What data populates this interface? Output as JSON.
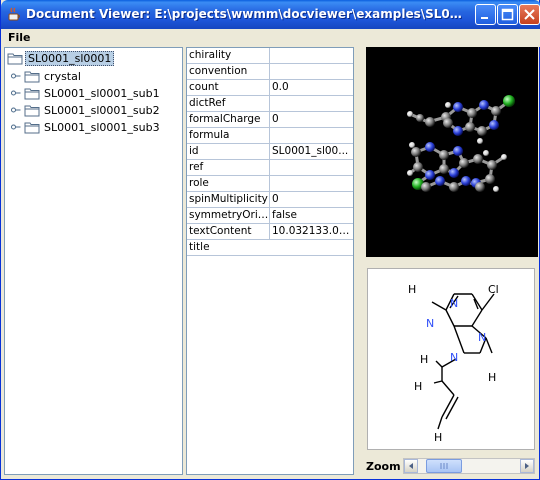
{
  "window": {
    "title": "Document Viewer: E:\\projects\\wwmm\\docviewer\\examples\\SL0001_sl0001..."
  },
  "menu": {
    "file_label": "File"
  },
  "tree": {
    "root": "SL0001_sl0001",
    "children": [
      "crystal",
      "SL0001_sl0001_sub1",
      "SL0001_sl0001_sub2",
      "SL0001_sl0001_sub3"
    ]
  },
  "properties": [
    {
      "key": "chirality",
      "value": ""
    },
    {
      "key": "convention",
      "value": ""
    },
    {
      "key": "count",
      "value": "0.0"
    },
    {
      "key": "dictRef",
      "value": ""
    },
    {
      "key": "formalCharge",
      "value": "0"
    },
    {
      "key": "formula",
      "value": ""
    },
    {
      "key": "id",
      "value": "SL0001_sl00..."
    },
    {
      "key": "ref",
      "value": ""
    },
    {
      "key": "role",
      "value": ""
    },
    {
      "key": "spinMultiplicity",
      "value": "0"
    },
    {
      "key": "symmetryOrie...",
      "value": "false"
    },
    {
      "key": "textContent",
      "value": "10.032133.06..."
    },
    {
      "key": "title",
      "value": ""
    }
  ],
  "structure2d": {
    "atoms": {
      "h1": "H",
      "cl": "Cl",
      "n1": "N",
      "n2": "N",
      "n3": "N",
      "n4": "N",
      "h2": "H",
      "h3": "H",
      "h4": "H",
      "h5": "H"
    }
  },
  "zoom": {
    "label": "Zoom",
    "level": 0.12
  },
  "colors": {
    "titlebar": "#1d55d8",
    "selection": "#b8cfe5",
    "nitrogen": "#3050f8",
    "chlorine": "#1fb01f"
  }
}
